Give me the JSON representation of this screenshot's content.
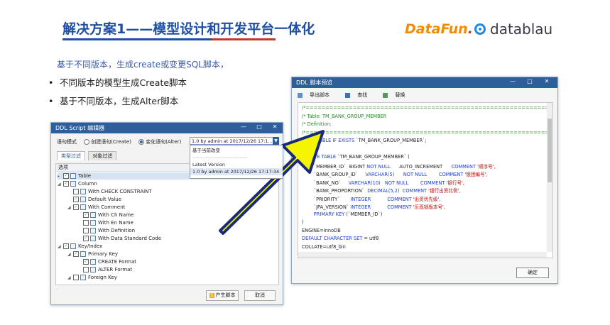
{
  "slide": {
    "title": "解决方案1——模型设计和开发平台一体化",
    "subtitle": "基于不同版本，生成create或变更SQL脚本，",
    "bullets": [
      "不同版本的模型生成Create脚本",
      "基于不同版本，生成Alter脚本"
    ],
    "bullet_glyph": "•",
    "logo_datafun_a": "DataFun",
    "logo_datafun_b": ".",
    "logo_datablau": "datablau"
  },
  "left_window": {
    "title": "DDL Script 编辑器",
    "controls": [
      "—",
      "□",
      "✕"
    ],
    "mode_label": "语句模式",
    "radio_create": "创建语句(Create)",
    "radio_alter": "变化语句(Alter)",
    "selected_version": "1.0 by admin at 2017/12/26 17:1...",
    "dropdown": {
      "items": [
        "基于当前改变",
        "---------------------------------",
        "Latest Version",
        "1.0 by admin at 2017/12/26 17:17:34"
      ]
    },
    "tabs": [
      "类型过滤",
      "对象过滤"
    ],
    "tree_header": "选项",
    "tree": [
      {
        "label": "Table",
        "checked": true,
        "expander": "▸"
      },
      {
        "label": "Column",
        "checked": true,
        "expander": "◢"
      },
      {
        "label": "With CHECK CONSTRAINT",
        "checked": false,
        "expander": ""
      },
      {
        "label": "Default Value",
        "checked": true,
        "expander": ""
      },
      {
        "label": "With Comment",
        "checked": true,
        "expander": "◢"
      },
      {
        "label": "With Ch Name",
        "checked": true,
        "expander": ""
      },
      {
        "label": "With En Name",
        "checked": false,
        "expander": ""
      },
      {
        "label": "With Definition",
        "checked": false,
        "expander": ""
      },
      {
        "label": "With Data Standard Code",
        "checked": true,
        "expander": ""
      },
      {
        "label": "Key/Index",
        "checked": true,
        "expander": "◢"
      },
      {
        "label": "Primary Key",
        "checked": true,
        "expander": "◢"
      },
      {
        "label": "CREATE Format",
        "checked": true,
        "expander": ""
      },
      {
        "label": "ALTER Format",
        "checked": false,
        "expander": ""
      },
      {
        "label": "Foreign Key",
        "checked": false,
        "expander": "◢"
      }
    ],
    "generate_button": "产生脚本",
    "cancel_button": "取消"
  },
  "right_window": {
    "title": "DDL 脚本预览",
    "controls": [
      "—",
      "□",
      "✕"
    ],
    "toolbar": {
      "export": "导出脚本",
      "find": "查找",
      "replace": "替换"
    },
    "sql_lines": [
      {
        "parts": [
          [
            "c-comment",
            "/*==============================================================*/"
          ]
        ]
      },
      {
        "parts": [
          [
            "c-comment",
            "/* Table: TM_BANK_GROUP_MEMBER"
          ]
        ]
      },
      {
        "parts": [
          [
            "c-comment",
            "/* Definition:"
          ]
        ]
      },
      {
        "parts": [
          [
            "c-comment",
            "/*==============================================================*/"
          ]
        ]
      },
      {
        "parts": [
          [
            "c-kw",
            "DROP TABLE IF EXISTS "
          ],
          [
            "c-plain",
            "`TM_BANK_GROUP_MEMBER`;"
          ]
        ]
      },
      {
        "parts": [
          [
            "c-plain",
            ""
          ]
        ]
      },
      {
        "parts": [
          [
            "c-kw",
            "CREATE TABLE "
          ],
          [
            "c-plain",
            "`TM_BANK_GROUP_MEMBER` ("
          ]
        ]
      },
      {
        "parts": [
          [
            "c-plain",
            "        `MEMBER_ID`  BIGINT "
          ],
          [
            "c-kw",
            "NOT NULL"
          ],
          [
            "c-plain",
            "      AUTO_INCREMENT      "
          ],
          [
            "c-kw",
            "COMMENT "
          ],
          [
            "c-str",
            "'顺序号',"
          ]
        ]
      },
      {
        "parts": [
          [
            "c-plain",
            "        `BANK_GROUP_ID`     "
          ],
          [
            "c-kw",
            "VARCHAR(5)"
          ],
          [
            "c-plain",
            "      "
          ],
          [
            "c-kw",
            "NOT NULL"
          ],
          [
            "c-plain",
            "        "
          ],
          [
            "c-kw",
            "COMMENT "
          ],
          [
            "c-str",
            "'银团编号',"
          ]
        ]
      },
      {
        "parts": [
          [
            "c-plain",
            "        `BANK_NO`     "
          ],
          [
            "c-kw",
            "VARCHAR(10)"
          ],
          [
            "c-plain",
            "   "
          ],
          [
            "c-kw",
            "NOT NULL"
          ],
          [
            "c-plain",
            "        "
          ],
          [
            "c-kw",
            "COMMENT "
          ],
          [
            "c-str",
            "'银行号',"
          ]
        ]
      },
      {
        "parts": [
          [
            "c-plain",
            "        `BANK_PROPORTION`  "
          ],
          [
            "c-kw",
            "DECIMAL(5,2)"
          ],
          [
            "c-plain",
            "  "
          ],
          [
            "c-kw",
            "COMMENT "
          ],
          [
            "c-str",
            "'银行出资比例',"
          ]
        ]
      },
      {
        "parts": [
          [
            "c-plain",
            "        `PRIORITY`       "
          ],
          [
            "c-kw",
            "INTEGER"
          ],
          [
            "c-plain",
            "           "
          ],
          [
            "c-kw",
            "COMMENT "
          ],
          [
            "c-str",
            "'出资优先级',"
          ]
        ]
      },
      {
        "parts": [
          [
            "c-plain",
            "        `JPA_VERSION` "
          ],
          [
            "c-kw",
            "INTEGER"
          ],
          [
            "c-plain",
            "           "
          ],
          [
            "c-kw",
            "COMMENT "
          ],
          [
            "c-str",
            "'乐观锁版本号',"
          ]
        ]
      },
      {
        "parts": [
          [
            "c-plain",
            "        "
          ],
          [
            "c-kw",
            "PRIMARY KEY "
          ],
          [
            "c-plain",
            "(`MEMBER_ID`)"
          ]
        ]
      },
      {
        "parts": [
          [
            "c-plain",
            ")"
          ]
        ]
      },
      {
        "parts": [
          [
            "c-plain",
            "ENGINE=InnoDB"
          ]
        ]
      },
      {
        "parts": [
          [
            "c-kw",
            "DEFAULT CHARACTER SET "
          ],
          [
            "c-plain",
            "= utf8"
          ]
        ]
      },
      {
        "parts": [
          [
            "c-plain",
            "COLLATE=utf8_bin"
          ]
        ]
      }
    ],
    "ok_button": "确定"
  },
  "colors": {
    "accent_blue": "#1f4fa5",
    "arrow_yellow": "#f5f500",
    "arrow_outline": "#1a2a7a"
  }
}
